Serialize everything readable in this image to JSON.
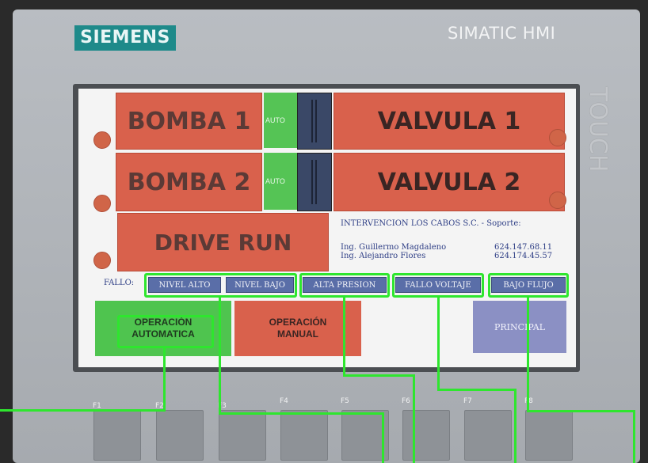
{
  "device": {
    "brand": "SIEMENS",
    "model": "SIMATIC HMI",
    "touch_label": "TOUCH"
  },
  "screen": {
    "bomba1": "BOMBA 1",
    "bomba2": "BOMBA 2",
    "valvula1": "VALVULA 1",
    "valvula2": "VALVULA 2",
    "drive_run": "DRIVE RUN",
    "auto1": "AUTO",
    "auto2": "AUTO",
    "info": {
      "company": "INTERVENCION LOS CABOS S.C. - Soporte:",
      "contacts": [
        {
          "name": "Ing. Guillermo Magdaleno",
          "phone": "624.147.68.11"
        },
        {
          "name": "Ing. Alejandro Flores",
          "phone": "624.174.45.57"
        }
      ]
    },
    "fallo_label": "FALLO:",
    "faults": [
      "NIVEL ALTO",
      "NIVEL BAJO",
      "ALTA PRESION",
      "FALLO VOLTAJE",
      "BAJO FLUJO"
    ],
    "modes": {
      "auto_line1": "OPERACIÓN",
      "auto_line2": "AUTOMATICA",
      "manual_line1": "OPERACIÓN",
      "manual_line2": "MANUAL",
      "principal": "PRINCIPAL"
    }
  },
  "function_keys": [
    "F1",
    "F2",
    "F3",
    "F4",
    "F5",
    "F6",
    "F7",
    "F8"
  ],
  "colors": {
    "alarm_red": "#d9614c",
    "auto_green": "#55c455",
    "fault_blue": "#5a6ea8",
    "highlight": "#2ee62e",
    "brand_teal": "#1e8a8a"
  }
}
